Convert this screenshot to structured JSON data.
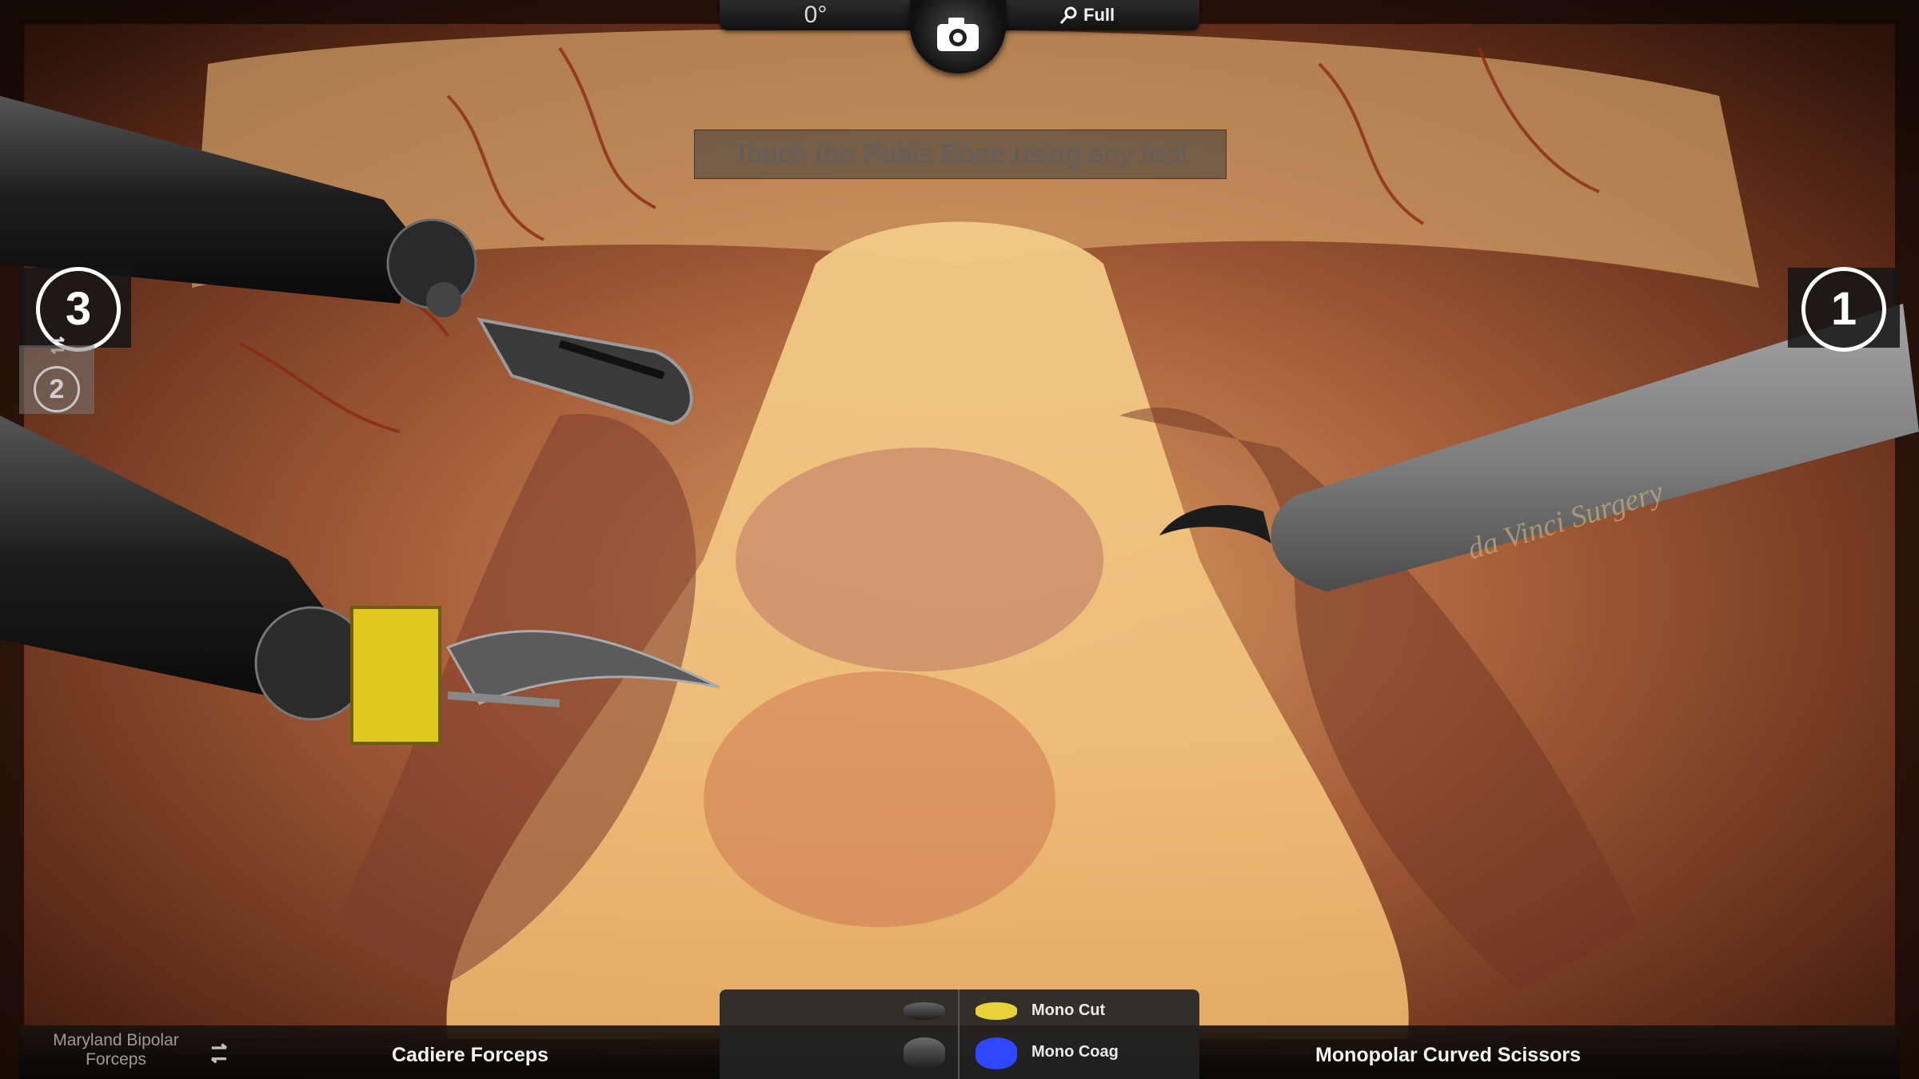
{
  "camera": {
    "angle": "0°",
    "zoom_label": "Full",
    "camera_icon": "camera-icon",
    "zoom_icon": "magnifier-icon"
  },
  "instruction": "Touch the Pubis Bone using any tool",
  "arms": {
    "left_active_number": "3",
    "left_secondary_number": "2",
    "right_active_number": "1",
    "swap_icon": "swap-arrows-icon"
  },
  "tools": {
    "inactive_left_label": "Maryland Bipolar Forceps",
    "active_left_label": "Cadiere Forceps",
    "right_label": "Monopolar Curved Scissors"
  },
  "energy": {
    "cut_label": "Mono Cut",
    "coag_label": "Mono Coag",
    "cut_color": "#e8d23a",
    "coag_color": "#2f47ff"
  },
  "instrument_brand": "da Vinci Surgery"
}
